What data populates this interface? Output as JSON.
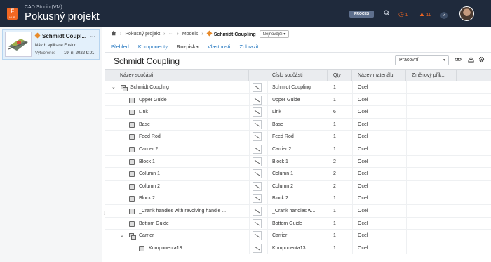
{
  "topbar": {
    "logo_letter": "F",
    "logo_small": "HUB",
    "hub_name": "CAD Studio (VM)",
    "project_title": "Pokusný projekt",
    "process_badge": "PROCES",
    "jobs_count": "1",
    "notifications_count": "11",
    "help_label": "?"
  },
  "file_card": {
    "title": "Schmidt Coupl...",
    "more_label": "...",
    "subtitle": "Návrh aplikace Fusion",
    "created_label": "Vytvořeno:",
    "created_value": "19. říj 2022 9:01"
  },
  "breadcrumb": {
    "items": [
      "Pokusný projekt",
      "···",
      "Models"
    ],
    "current": "Schmidt Coupling",
    "version": "Nejnovější"
  },
  "tabs": [
    "Přehled",
    "Komponenty",
    "Rozpiska",
    "Vlastnosti",
    "Zobrazit"
  ],
  "active_tab": "Rozpiska",
  "bom": {
    "title": "Schmidt Coupling",
    "view_select": "Pracovní",
    "columns": [
      "Název součásti",
      "",
      "Číslo součásti",
      "Qty",
      "Název materiálu",
      "Změnový přík..."
    ],
    "rows": [
      {
        "name": "Schmidt Coupling",
        "number": "Schmidt Coupling",
        "qty": "1",
        "material": "Ocel"
      },
      {
        "name": "Upper Guide",
        "number": "Upper Guide",
        "qty": "1",
        "material": "Ocel"
      },
      {
        "name": "Link",
        "number": "Link",
        "qty": "6",
        "material": "Ocel"
      },
      {
        "name": "Base",
        "number": "Base",
        "qty": "1",
        "material": "Ocel"
      },
      {
        "name": "Feed Rod",
        "number": "Feed Rod",
        "qty": "1",
        "material": "Ocel"
      },
      {
        "name": "Carrier 2",
        "number": "Carrier 2",
        "qty": "1",
        "material": "Ocel"
      },
      {
        "name": "Block 1",
        "number": "Block 1",
        "qty": "2",
        "material": "Ocel"
      },
      {
        "name": "Column 1",
        "number": "Column 1",
        "qty": "2",
        "material": "Ocel"
      },
      {
        "name": "Column 2",
        "number": "Column 2",
        "qty": "2",
        "material": "Ocel"
      },
      {
        "name": "Block 2",
        "number": "Block 2",
        "qty": "1",
        "material": "Ocel"
      },
      {
        "name": "_Crank handles with revolving handle ...",
        "number": "_Crank handles w...",
        "qty": "1",
        "material": "Ocel"
      },
      {
        "name": "Bottom Guide",
        "number": "Bottom Guide",
        "qty": "1",
        "material": "Ocel"
      },
      {
        "name": "Carrier",
        "number": "Carrier",
        "qty": "1",
        "material": "Ocel"
      },
      {
        "name": "Komponenta13",
        "number": "Komponenta13",
        "qty": "1",
        "material": "Ocel"
      }
    ]
  },
  "colors": {
    "topbar_bg": "#1f2a3c",
    "accent": "#1e73be",
    "logo": "#f26722",
    "alert": "#f26722"
  },
  "icons": [
    "home-icon",
    "cube-icon",
    "search-icon",
    "jobs-icon",
    "bell-icon",
    "help-icon",
    "link-icon",
    "download-icon",
    "gear-icon"
  ]
}
